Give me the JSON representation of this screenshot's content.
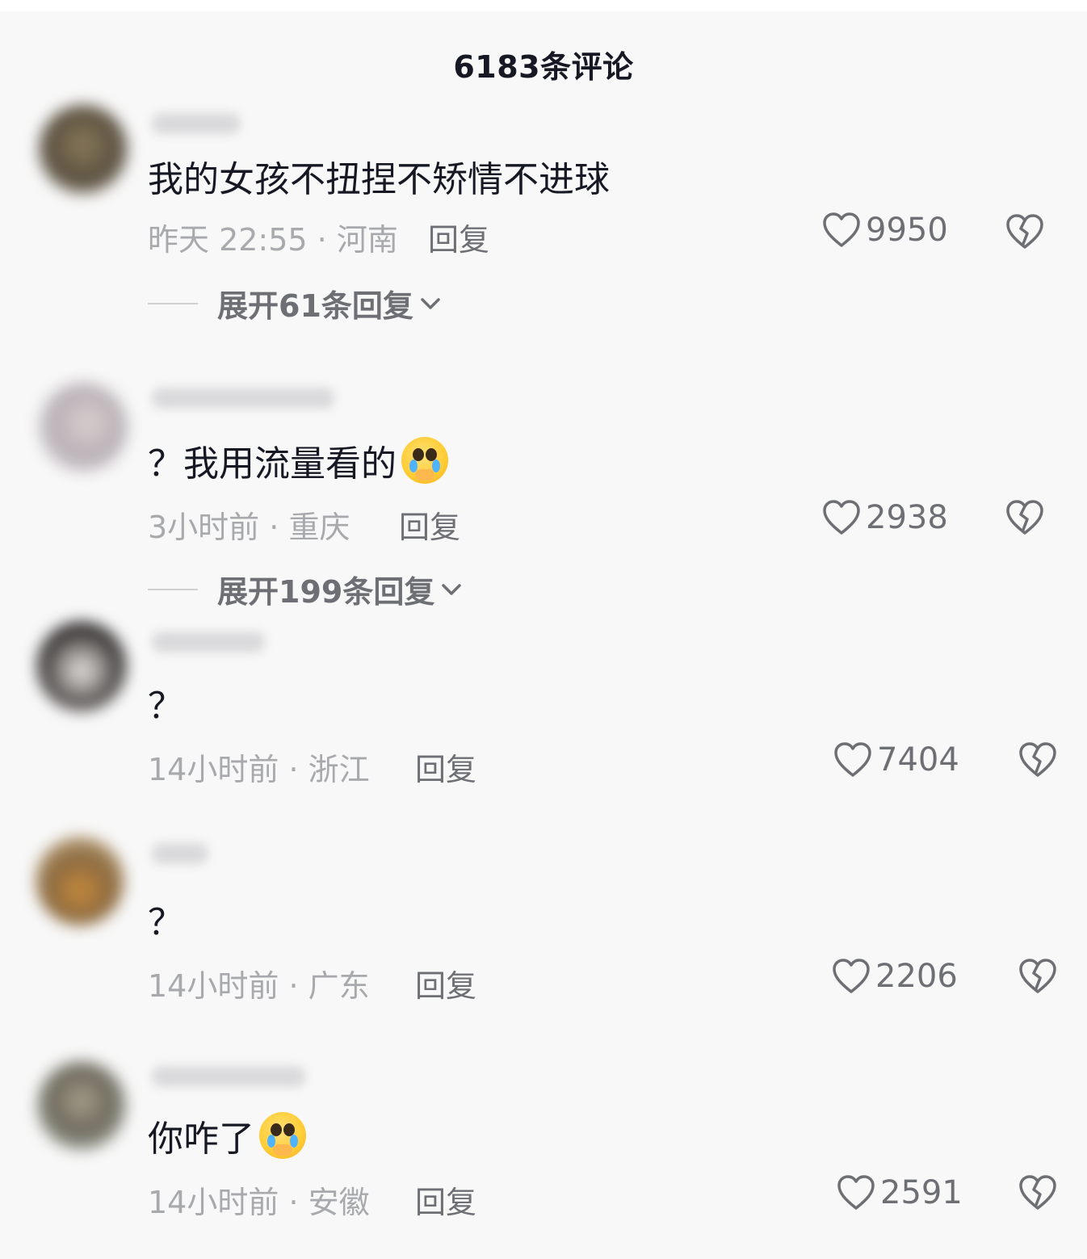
{
  "header": {
    "title": "6183条评论"
  },
  "comments": [
    {
      "text": "我的女孩不扭捏不矫情不进球",
      "time": "昨天 22:55",
      "location": "河南",
      "reply_label": "回复",
      "likes": "9950",
      "expand_label": "展开61条回复",
      "has_emoji": false
    },
    {
      "text": "？我用流量看的",
      "time": "3小时前",
      "location": "重庆",
      "reply_label": "回复",
      "likes": "2938",
      "expand_label": "展开199条回复",
      "has_emoji": true
    },
    {
      "text": "？",
      "time": "14小时前",
      "location": "浙江",
      "reply_label": "回复",
      "likes": "7404",
      "has_emoji": false
    },
    {
      "text": "？",
      "time": "14小时前",
      "location": "广东",
      "reply_label": "回复",
      "likes": "2206",
      "has_emoji": false
    },
    {
      "text": "你咋了",
      "time": "14小时前",
      "location": "安徽",
      "reply_label": "回复",
      "likes": "2591",
      "has_emoji": true
    }
  ],
  "meta_separator": " · ",
  "icons": {
    "like": "heart-outline-icon",
    "dislike": "broken-heart-icon",
    "expand": "chevron-down-icon",
    "emoji": "crying-face-emoji"
  }
}
